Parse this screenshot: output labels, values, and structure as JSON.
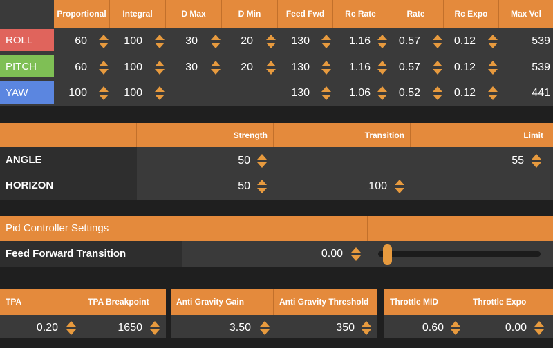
{
  "pid_table": {
    "columns": [
      "Proportional",
      "Integral",
      "D Max",
      "D Min",
      "Feed Fwd",
      "Rc Rate",
      "Rate",
      "Rc Expo",
      "Max Vel"
    ],
    "rows": [
      {
        "label": "ROLL",
        "color": "#e0645c",
        "values": [
          "60",
          "100",
          "30",
          "20",
          "130",
          "1.16",
          "0.57",
          "0.12",
          "539"
        ]
      },
      {
        "label": "PITCH",
        "color": "#7fbf55",
        "values": [
          "60",
          "100",
          "30",
          "20",
          "130",
          "1.16",
          "0.57",
          "0.12",
          "539"
        ]
      },
      {
        "label": "YAW",
        "color": "#5b86e0",
        "values": [
          "100",
          "100",
          "",
          "",
          "130",
          "1.06",
          "0.52",
          "0.12",
          "441"
        ]
      }
    ]
  },
  "modes_table": {
    "columns": [
      "Strength",
      "Transition",
      "Limit"
    ],
    "rows": [
      {
        "label": "ANGLE",
        "strength": "50",
        "transition": "",
        "limit": "55"
      },
      {
        "label": "HORIZON",
        "strength": "50",
        "transition": "100",
        "limit": ""
      }
    ]
  },
  "pid_controller": {
    "title": "Pid Controller Settings",
    "ff_transition_label": "Feed Forward Transition",
    "ff_transition_value": "0.00",
    "ff_slider_level": 0.0
  },
  "bottom": {
    "tpa": {
      "label": "TPA",
      "value": "0.20"
    },
    "tpa_breakpoint": {
      "label": "TPA Breakpoint",
      "value": "1650"
    },
    "ag_gain": {
      "label": "Anti Gravity Gain",
      "value": "3.50"
    },
    "ag_threshold": {
      "label": "Anti Gravity Threshold",
      "value": "350"
    },
    "throttle_mid": {
      "label": "Throttle MID",
      "value": "0.60"
    },
    "throttle_expo": {
      "label": "Throttle Expo",
      "value": "0.00"
    }
  },
  "colors": {
    "accent": "#e48a3c",
    "spinner": "#e79a3e"
  }
}
